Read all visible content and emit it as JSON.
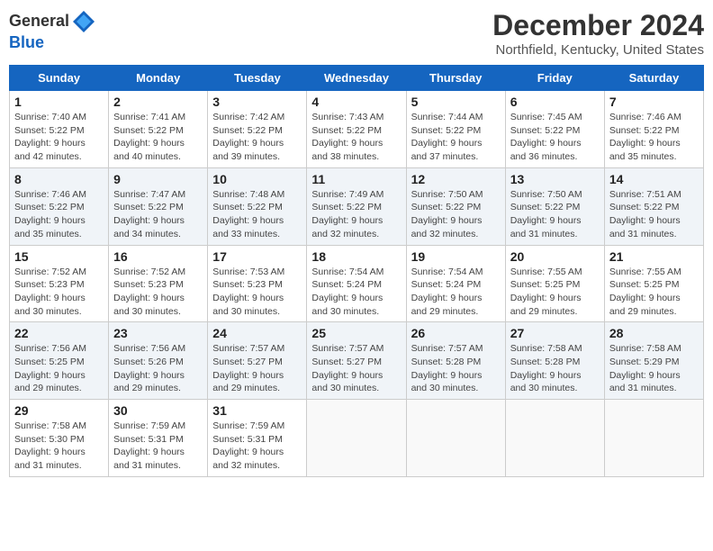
{
  "header": {
    "logo_line1": "General",
    "logo_line2": "Blue",
    "title": "December 2024",
    "subtitle": "Northfield, Kentucky, United States"
  },
  "weekdays": [
    "Sunday",
    "Monday",
    "Tuesday",
    "Wednesday",
    "Thursday",
    "Friday",
    "Saturday"
  ],
  "weeks": [
    [
      {
        "day": "1",
        "sunrise": "7:40 AM",
        "sunset": "5:22 PM",
        "daylight": "9 hours and 42 minutes."
      },
      {
        "day": "2",
        "sunrise": "7:41 AM",
        "sunset": "5:22 PM",
        "daylight": "9 hours and 40 minutes."
      },
      {
        "day": "3",
        "sunrise": "7:42 AM",
        "sunset": "5:22 PM",
        "daylight": "9 hours and 39 minutes."
      },
      {
        "day": "4",
        "sunrise": "7:43 AM",
        "sunset": "5:22 PM",
        "daylight": "9 hours and 38 minutes."
      },
      {
        "day": "5",
        "sunrise": "7:44 AM",
        "sunset": "5:22 PM",
        "daylight": "9 hours and 37 minutes."
      },
      {
        "day": "6",
        "sunrise": "7:45 AM",
        "sunset": "5:22 PM",
        "daylight": "9 hours and 36 minutes."
      },
      {
        "day": "7",
        "sunrise": "7:46 AM",
        "sunset": "5:22 PM",
        "daylight": "9 hours and 35 minutes."
      }
    ],
    [
      {
        "day": "8",
        "sunrise": "7:46 AM",
        "sunset": "5:22 PM",
        "daylight": "9 hours and 35 minutes."
      },
      {
        "day": "9",
        "sunrise": "7:47 AM",
        "sunset": "5:22 PM",
        "daylight": "9 hours and 34 minutes."
      },
      {
        "day": "10",
        "sunrise": "7:48 AM",
        "sunset": "5:22 PM",
        "daylight": "9 hours and 33 minutes."
      },
      {
        "day": "11",
        "sunrise": "7:49 AM",
        "sunset": "5:22 PM",
        "daylight": "9 hours and 32 minutes."
      },
      {
        "day": "12",
        "sunrise": "7:50 AM",
        "sunset": "5:22 PM",
        "daylight": "9 hours and 32 minutes."
      },
      {
        "day": "13",
        "sunrise": "7:50 AM",
        "sunset": "5:22 PM",
        "daylight": "9 hours and 31 minutes."
      },
      {
        "day": "14",
        "sunrise": "7:51 AM",
        "sunset": "5:22 PM",
        "daylight": "9 hours and 31 minutes."
      }
    ],
    [
      {
        "day": "15",
        "sunrise": "7:52 AM",
        "sunset": "5:23 PM",
        "daylight": "9 hours and 30 minutes."
      },
      {
        "day": "16",
        "sunrise": "7:52 AM",
        "sunset": "5:23 PM",
        "daylight": "9 hours and 30 minutes."
      },
      {
        "day": "17",
        "sunrise": "7:53 AM",
        "sunset": "5:23 PM",
        "daylight": "9 hours and 30 minutes."
      },
      {
        "day": "18",
        "sunrise": "7:54 AM",
        "sunset": "5:24 PM",
        "daylight": "9 hours and 30 minutes."
      },
      {
        "day": "19",
        "sunrise": "7:54 AM",
        "sunset": "5:24 PM",
        "daylight": "9 hours and 29 minutes."
      },
      {
        "day": "20",
        "sunrise": "7:55 AM",
        "sunset": "5:25 PM",
        "daylight": "9 hours and 29 minutes."
      },
      {
        "day": "21",
        "sunrise": "7:55 AM",
        "sunset": "5:25 PM",
        "daylight": "9 hours and 29 minutes."
      }
    ],
    [
      {
        "day": "22",
        "sunrise": "7:56 AM",
        "sunset": "5:25 PM",
        "daylight": "9 hours and 29 minutes."
      },
      {
        "day": "23",
        "sunrise": "7:56 AM",
        "sunset": "5:26 PM",
        "daylight": "9 hours and 29 minutes."
      },
      {
        "day": "24",
        "sunrise": "7:57 AM",
        "sunset": "5:27 PM",
        "daylight": "9 hours and 29 minutes."
      },
      {
        "day": "25",
        "sunrise": "7:57 AM",
        "sunset": "5:27 PM",
        "daylight": "9 hours and 30 minutes."
      },
      {
        "day": "26",
        "sunrise": "7:57 AM",
        "sunset": "5:28 PM",
        "daylight": "9 hours and 30 minutes."
      },
      {
        "day": "27",
        "sunrise": "7:58 AM",
        "sunset": "5:28 PM",
        "daylight": "9 hours and 30 minutes."
      },
      {
        "day": "28",
        "sunrise": "7:58 AM",
        "sunset": "5:29 PM",
        "daylight": "9 hours and 31 minutes."
      }
    ],
    [
      {
        "day": "29",
        "sunrise": "7:58 AM",
        "sunset": "5:30 PM",
        "daylight": "9 hours and 31 minutes."
      },
      {
        "day": "30",
        "sunrise": "7:59 AM",
        "sunset": "5:31 PM",
        "daylight": "9 hours and 31 minutes."
      },
      {
        "day": "31",
        "sunrise": "7:59 AM",
        "sunset": "5:31 PM",
        "daylight": "9 hours and 32 minutes."
      },
      null,
      null,
      null,
      null
    ]
  ]
}
